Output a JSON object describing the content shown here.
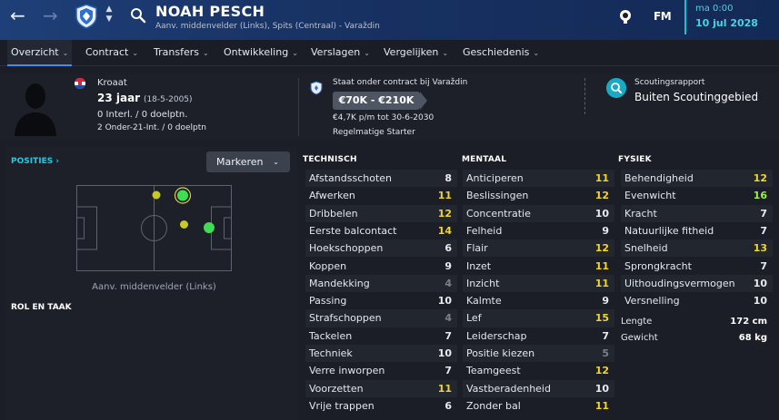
{
  "header": {
    "player_name": "NOAH PESCH",
    "positions": "Aanv. middenvelder (Links), Spits (Centraal) - Varaždin",
    "fm_logo": "FM",
    "date_day": "ma 0:00",
    "date_full": "10 jul 2028",
    "nav_back": "←",
    "nav_forward": "→",
    "updown_up": "▲",
    "updown_down": "▼"
  },
  "tabs": [
    {
      "label": "Overzicht",
      "active": true
    },
    {
      "label": "Contract"
    },
    {
      "label": "Transfers"
    },
    {
      "label": "Ontwikkeling"
    },
    {
      "label": "Verslagen"
    },
    {
      "label": "Vergelijken"
    },
    {
      "label": "Geschiedenis"
    }
  ],
  "tab_chevron": "⌄",
  "profile": {
    "nationality": "Kroaat",
    "age": "23 jaar",
    "dob": "(18-5-2005)",
    "international": "0 Interl. / 0 doelptn.",
    "u21": "2 Onder-21-Int. / 0 doelptn"
  },
  "contract": {
    "title": "Staat onder contract bij Varaždin",
    "value": "€70K - €210K",
    "wage": "€4,7K p/m tot 30-6-2030",
    "status": "Regelmatige Starter"
  },
  "scouting": {
    "title": "Scoutingsrapport",
    "value": "Buiten Scoutinggebied"
  },
  "positions_panel": {
    "title": "POSITIES ›",
    "markeren": "Markeren",
    "position_label": "Aanv. middenvelder (Links)",
    "rol_title": "ROL EN TAAK"
  },
  "colors": {
    "accent": "#24c7e0",
    "tab_active": "#3f8cf3",
    "header_blue": "#1e3f78",
    "attr_high": "#f2d52a",
    "attr_very_high": "#9fee4e"
  },
  "technisch": {
    "title": "TECHNISCH",
    "items": [
      {
        "name": "Afstandsschoten",
        "value": "8"
      },
      {
        "name": "Afwerken",
        "value": "11"
      },
      {
        "name": "Dribbelen",
        "value": "12"
      },
      {
        "name": "Eerste balcontact",
        "value": "14"
      },
      {
        "name": "Hoekschoppen",
        "value": "6"
      },
      {
        "name": "Koppen",
        "value": "9"
      },
      {
        "name": "Mandekking",
        "value": "4"
      },
      {
        "name": "Passing",
        "value": "10"
      },
      {
        "name": "Strafschoppen",
        "value": "4"
      },
      {
        "name": "Tackelen",
        "value": "7"
      },
      {
        "name": "Techniek",
        "value": "10"
      },
      {
        "name": "Verre inworpen",
        "value": "7"
      },
      {
        "name": "Voorzetten",
        "value": "11"
      },
      {
        "name": "Vrije trappen",
        "value": "6"
      }
    ]
  },
  "mentaal": {
    "title": "MENTAAL",
    "items": [
      {
        "name": "Anticiperen",
        "value": "11"
      },
      {
        "name": "Beslissingen",
        "value": "12"
      },
      {
        "name": "Concentratie",
        "value": "10"
      },
      {
        "name": "Felheid",
        "value": "9"
      },
      {
        "name": "Flair",
        "value": "12"
      },
      {
        "name": "Inzet",
        "value": "11"
      },
      {
        "name": "Inzicht",
        "value": "11"
      },
      {
        "name": "Kalmte",
        "value": "9"
      },
      {
        "name": "Lef",
        "value": "15"
      },
      {
        "name": "Leiderschap",
        "value": "7"
      },
      {
        "name": "Positie kiezen",
        "value": "5"
      },
      {
        "name": "Teamgeest",
        "value": "12"
      },
      {
        "name": "Vastberadenheid",
        "value": "10"
      },
      {
        "name": "Zonder bal",
        "value": "11"
      }
    ]
  },
  "fysiek": {
    "title": "FYSIEK",
    "items": [
      {
        "name": "Behendigheid",
        "value": "12"
      },
      {
        "name": "Evenwicht",
        "value": "16"
      },
      {
        "name": "Kracht",
        "value": "7"
      },
      {
        "name": "Natuurlijke fitheid",
        "value": "7"
      },
      {
        "name": "Snelheid",
        "value": "13"
      },
      {
        "name": "Sprongkracht",
        "value": "7"
      },
      {
        "name": "Uithoudingsvermogen",
        "value": "10"
      },
      {
        "name": "Versnelling",
        "value": "10"
      }
    ],
    "lengte_label": "Lengte",
    "lengte_value": "172 cm",
    "gewicht_label": "Gewicht",
    "gewicht_value": "68 kg"
  }
}
